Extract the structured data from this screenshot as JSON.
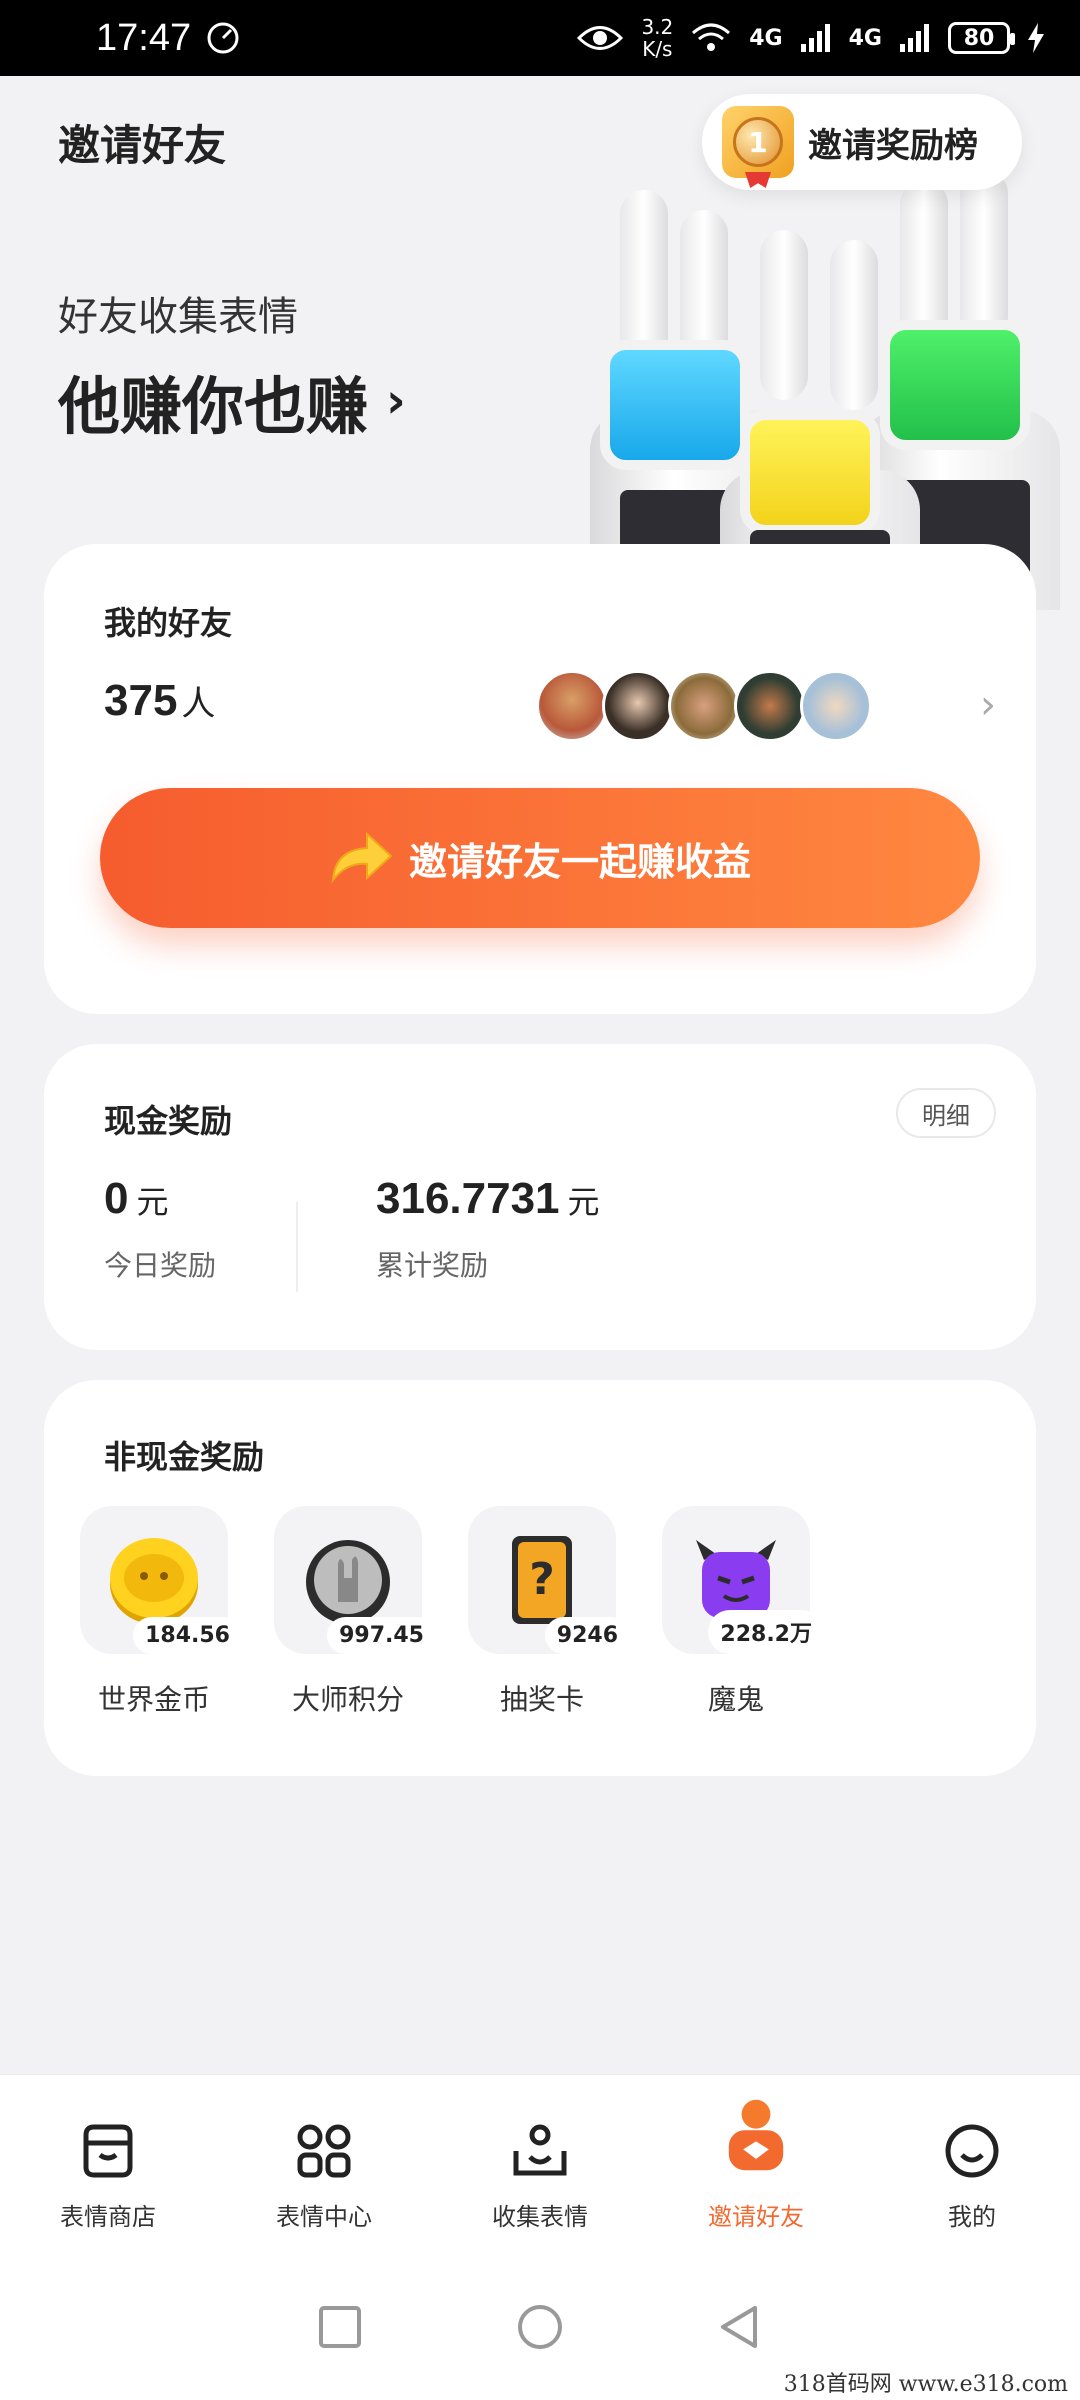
{
  "status_bar": {
    "time": "17:47",
    "net_speed_top": "3.2",
    "net_speed_bottom": "K/s",
    "signal1": "4G",
    "signal2": "4G",
    "battery": "80"
  },
  "header": {
    "title": "邀请好友",
    "rank_button_label": "邀请奖励榜",
    "medal_number": "1"
  },
  "hero": {
    "subtitle": "好友收集表情",
    "headline": "他赚你也赚",
    "chevron": "›"
  },
  "friends": {
    "title": "我的好友",
    "count": "375",
    "unit": "人",
    "invite_button_label": "邀请好友一起赚收益",
    "chevron": "›"
  },
  "cash": {
    "title": "现金奖励",
    "detail_label": "明细",
    "today_value": "0",
    "today_unit": "元",
    "today_label": "今日奖励",
    "total_value": "316.7731",
    "total_unit": "元",
    "total_label": "累计奖励"
  },
  "noncash": {
    "title": "非现金奖励",
    "items": [
      {
        "name": "世界金币",
        "value": "184.56",
        "icon": "gold-coin-icon"
      },
      {
        "name": "大师积分",
        "value": "997.45",
        "icon": "master-points-icon"
      },
      {
        "name": "抽奖卡",
        "value": "9246",
        "icon": "lottery-card-icon"
      },
      {
        "name": "魔鬼",
        "value": "228.2万",
        "icon": "devil-icon"
      }
    ]
  },
  "nav": {
    "items": [
      {
        "label": "表情商店",
        "icon": "store-icon"
      },
      {
        "label": "表情中心",
        "icon": "grid-icon"
      },
      {
        "label": "收集表情",
        "icon": "collect-icon"
      },
      {
        "label": "邀请好友",
        "icon": "invite-icon",
        "active": true
      },
      {
        "label": "我的",
        "icon": "profile-icon"
      }
    ]
  },
  "watermark": "318首码网  www.e318.com",
  "colors": {
    "accent": "#f26a2e",
    "button_gradient_start": "#f65c2e",
    "button_gradient_end": "#ff8840"
  }
}
